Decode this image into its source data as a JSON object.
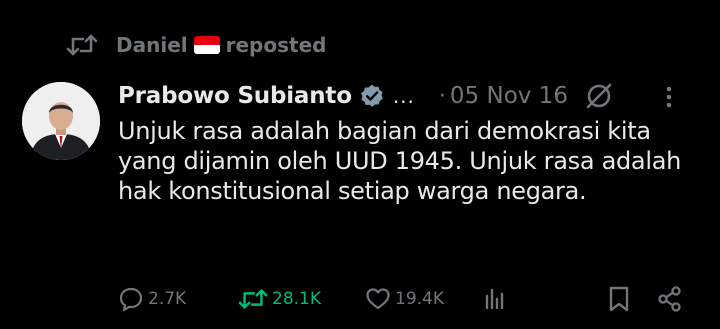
{
  "repost_banner": {
    "user": "Daniel",
    "label": "reposted"
  },
  "tweet": {
    "author_name": "Prabowo Subianto",
    "handle_ellipsis": "...",
    "separator": "·",
    "date": "05 Nov 16",
    "text": "Unjuk rasa adalah bagian dari demokrasi kita yang dijamin oleh UUD 1945. Unjuk rasa adalah hak konstitusional setiap warga negara."
  },
  "actions": {
    "replies": "2.7K",
    "reposts": "28.1K",
    "likes": "19.4K"
  },
  "colors": {
    "background": "#000000",
    "text_primary": "#e7e9ea",
    "text_secondary": "#71767b",
    "repost_active": "#00ba7c"
  },
  "icons": [
    "repost-icon",
    "indonesia-flag-icon",
    "verified-badge-icon",
    "no-symbol-icon",
    "more-options-icon",
    "reply-icon",
    "views-icon",
    "bookmark-icon",
    "share-icon"
  ]
}
